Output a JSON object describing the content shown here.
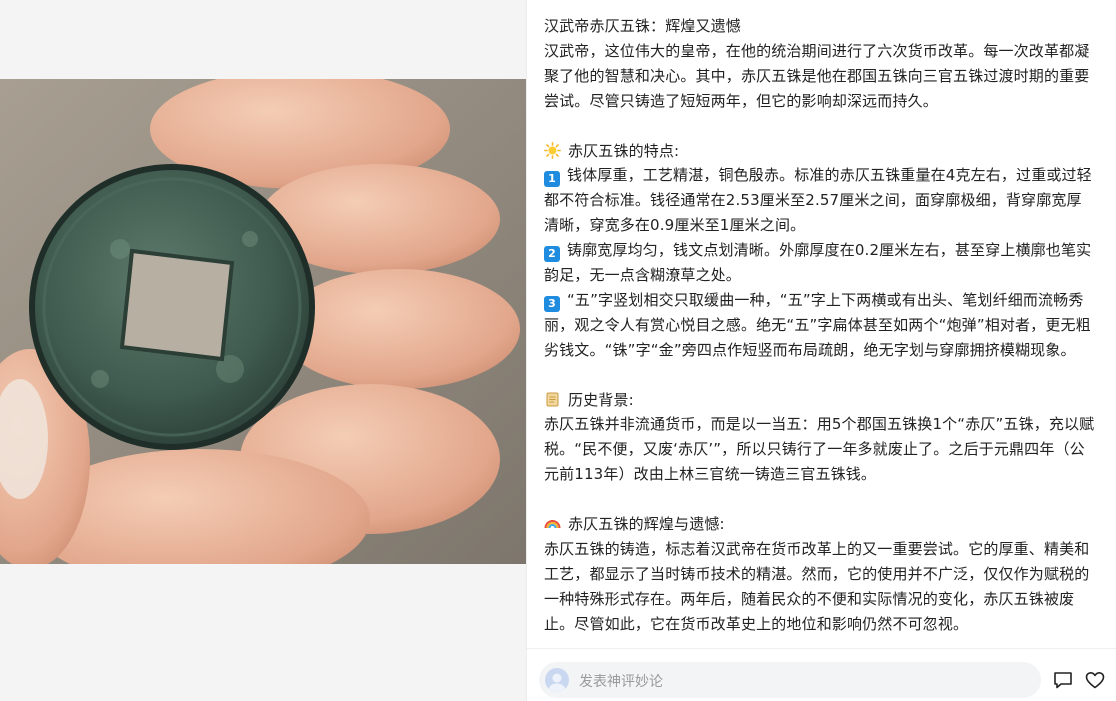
{
  "article": {
    "title": "汉武帝赤仄五铢：辉煌又遗憾",
    "intro": "汉武帝，这位伟大的皇帝，在他的统治期间进行了六次货币改革。每一次改革都凝聚了他的智慧和决心。其中，赤仄五铢是他在郡国五铢向三官五铢过渡时期的重要尝试。尽管只铸造了短短两年，但它的影响却深远而持久。",
    "features_heading": "赤仄五铢的特点:",
    "features": [
      {
        "num": "1",
        "text": "钱体厚重，工艺精湛，铜色殷赤。标准的赤仄五铢重量在4克左右，过重或过轻都不符合标准。钱径通常在2.53厘米至2.57厘米之间，面穿廓极细，背穿廓宽厚清晰，穿宽多在0.9厘米至1厘米之间。"
      },
      {
        "num": "2",
        "text": "铸廓宽厚均匀，钱文点划清晰。外廓厚度在0.2厘米左右，甚至穿上横廓也笔实韵足，无一点含糊潦草之处。"
      },
      {
        "num": "3",
        "text": "“五”字竖划相交只取缓曲一种，“五”字上下两横或有出头、笔划纤细而流畅秀丽，观之令人有赏心悦目之感。绝无“五”字扁体甚至如两个“炮弹”相对者，更无粗劣钱文。“铢”字“金”旁四点作短竖而布局疏朗，绝无字划与穿廓拥挤模糊现象。"
      }
    ],
    "history_heading": "历史背景:",
    "history": "赤仄五铢并非流通货币，而是以一当五：用5个郡国五铢换1个“赤仄”五铢，充以赋税。“民不便，又废‘赤仄’”，所以只铸行了一年多就废止了。之后于元鼎四年（公元前113年）改由上林三官统一铸造三官五铢钱。",
    "glory_heading": "赤仄五铢的辉煌与遗憾:",
    "glory": "赤仄五铢的铸造，标志着汉武帝在货币改革上的又一重要尝试。它的厚重、精美和工艺，都显示了当时铸币技术的精湛。然而，它的使用并不广泛，仅仅作为赋税的一种特殊形式存在。两年后，随着民众的不便和实际情况的变化，赤仄五铢被废止。尽管如此，它在货币改革史上的地位和影响仍然不可忽视。"
  },
  "comment": {
    "placeholder": "发表神评妙论"
  },
  "icons": {
    "features": "sun-icon",
    "history": "scroll-icon",
    "glory": "rainbow-icon",
    "comment": "comment-icon",
    "like": "heart-icon"
  },
  "colors": {
    "number_badge": "#1f8ce0",
    "coin": "#3e5a4e"
  }
}
